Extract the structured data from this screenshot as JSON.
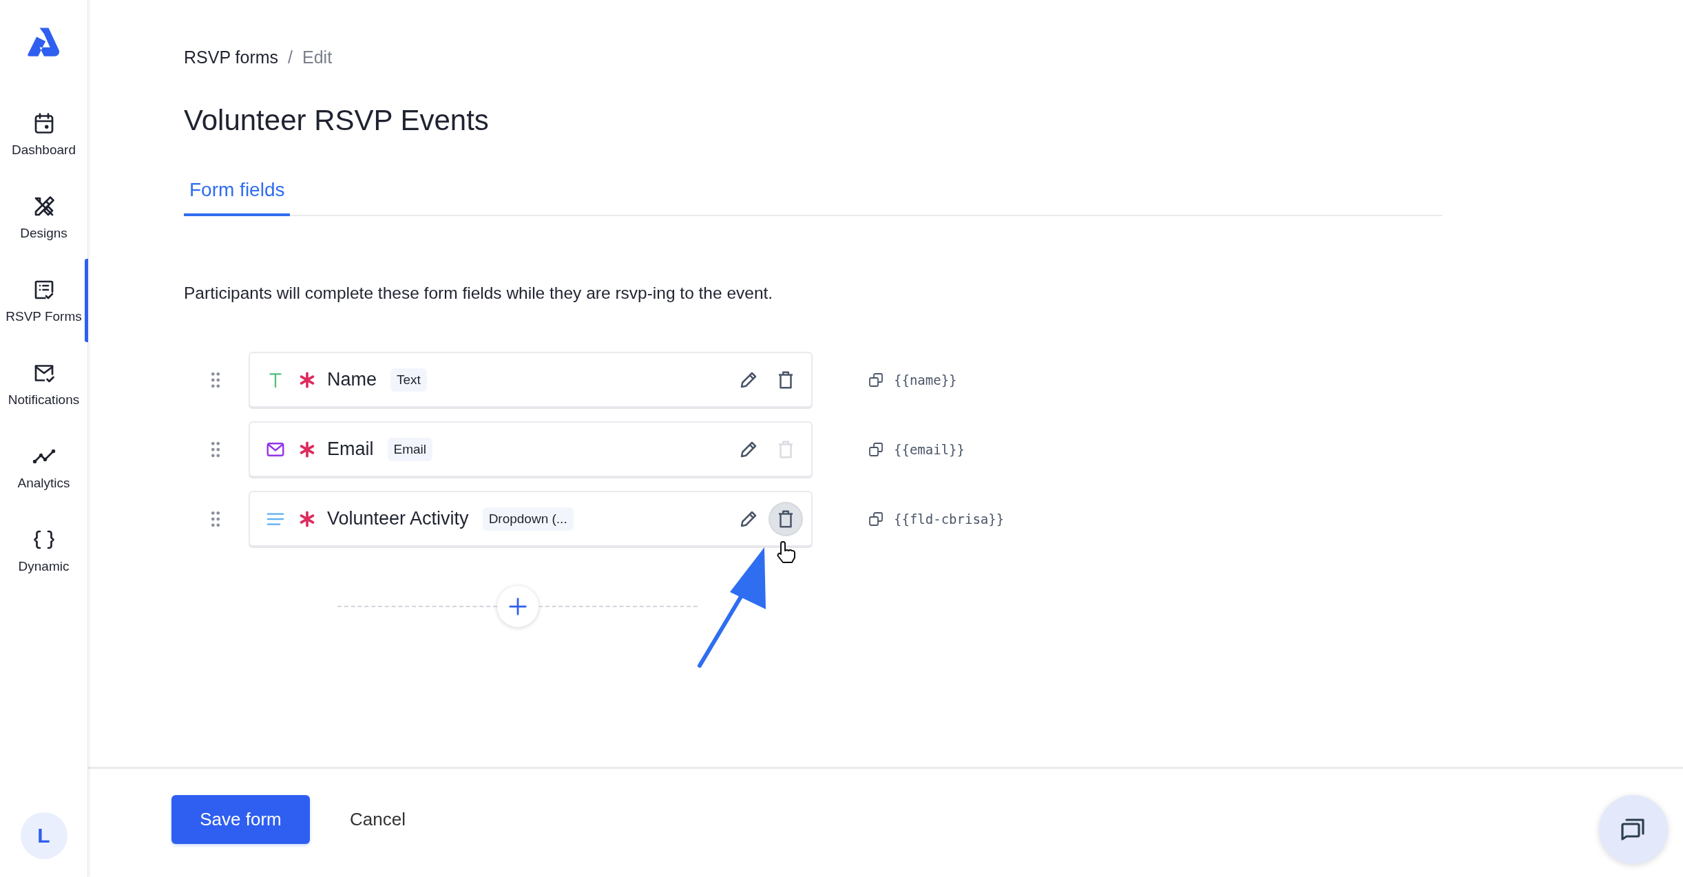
{
  "sidebar": {
    "items": [
      {
        "label": "Dashboard",
        "kind": "calendar",
        "selected": false
      },
      {
        "label": "Designs",
        "kind": "design",
        "selected": false
      },
      {
        "label": "RSVP Forms",
        "kind": "form",
        "selected": true
      },
      {
        "label": "Notifications",
        "kind": "mail",
        "selected": false
      },
      {
        "label": "Analytics",
        "kind": "chart",
        "selected": false
      },
      {
        "label": "Dynamic",
        "kind": "braces",
        "selected": false
      }
    ],
    "avatar": "L"
  },
  "breadcrumb": {
    "items": [
      "RSVP forms",
      "Edit"
    ],
    "separator": "/"
  },
  "title": "Volunteer RSVP Events",
  "tabs": [
    {
      "label": "Form fields",
      "selected": true
    }
  ],
  "description": "Participants will complete these form fields while they are rsvp-ing to the event.",
  "fields": [
    {
      "kind": "text",
      "required": true,
      "name": "Name",
      "type": "Text",
      "token": "{{name}}",
      "delete_disabled": false,
      "delete_hovered": false
    },
    {
      "kind": "email",
      "required": true,
      "name": "Email",
      "type": "Email",
      "token": "{{email}}",
      "delete_disabled": true,
      "delete_hovered": false
    },
    {
      "kind": "dropdown",
      "required": true,
      "name": "Volunteer Activity",
      "type": "Dropdown (...",
      "token": "{{fld-cbrisa}}",
      "delete_disabled": false,
      "delete_hovered": true
    }
  ],
  "footer": {
    "save_button": "Save form",
    "cancel_button": "Cancel"
  }
}
